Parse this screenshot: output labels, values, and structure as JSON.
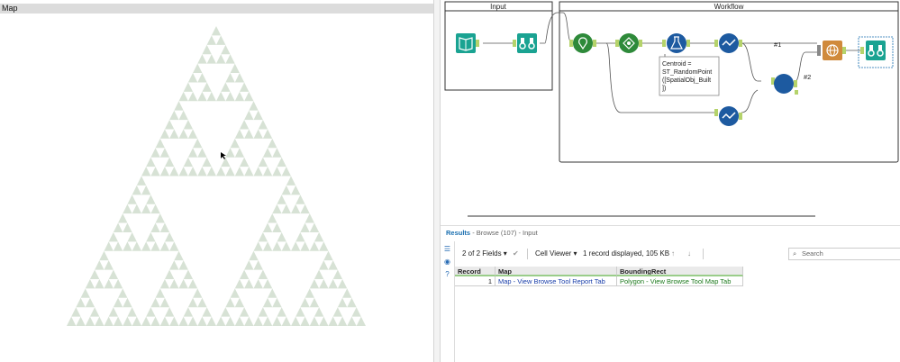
{
  "map_panel": {
    "title": "Map"
  },
  "workflow": {
    "input_container_label": "Input",
    "workflow_container_label": "Workflow",
    "formula_annotation": [
      "Centroid =",
      "ST_RandomPoint",
      "([SpatialObj_Built",
      "])"
    ],
    "anchor_1": "#1",
    "anchor_2": "#2"
  },
  "results": {
    "title": "Results",
    "subtitle": "- Browse (107) - Input",
    "fields_label": "2 of 2 Fields",
    "cell_viewer_label": "Cell Viewer",
    "record_info": "1 record displayed, 105 KB",
    "search_placeholder": "Search",
    "columns": [
      "Record",
      "Map",
      "BoundingRect"
    ],
    "rows": [
      {
        "record": "1",
        "map": "Map - View Browse Tool Report Tab",
        "bounding": "Polygon - View Browse Tool Map Tab"
      }
    ]
  },
  "colors": {
    "fractal": "#d7e2d5",
    "node_green": "#2e8a3a",
    "node_teal": "#1aa392",
    "node_blue": "#1d5aa0",
    "node_orange": "#d08a3c"
  }
}
